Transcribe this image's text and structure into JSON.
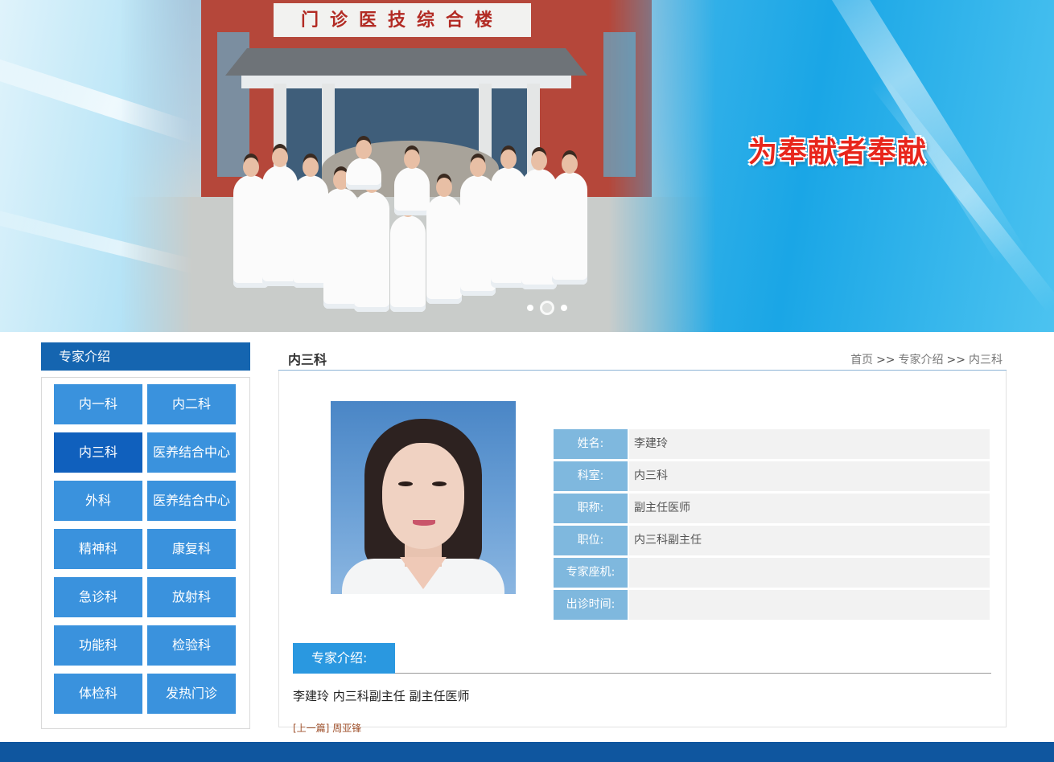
{
  "banner": {
    "building_sign": "门诊医技综合楼",
    "slogan": "为奉献者奉献",
    "slides": 3,
    "active_slide": 1
  },
  "sidebar": {
    "title": "专家介绍",
    "departments": [
      "内一科",
      "内二科",
      "内三科",
      "医养结合中心",
      "外科",
      "医养结合中心",
      "精神科",
      "康复科",
      "急诊科",
      "放射科",
      "功能科",
      "检验科",
      "体检科",
      "发热门诊"
    ],
    "active_index": 2
  },
  "main": {
    "title": "内三科",
    "breadcrumb": {
      "home": "首页",
      "sep1": ">>",
      "section": "专家介绍",
      "sep2": ">>",
      "current": "内三科"
    },
    "profile": [
      {
        "label": "姓名:",
        "value": "李建玲"
      },
      {
        "label": "科室:",
        "value": "内三科"
      },
      {
        "label": "职称:",
        "value": "副主任医师"
      },
      {
        "label": "职位:",
        "value": "内三科副主任"
      },
      {
        "label": "专家座机:",
        "value": ""
      },
      {
        "label": "出诊时间:",
        "value": ""
      }
    ],
    "intro_tab": "专家介绍:",
    "intro_text": "李建玲 内三科副主任 副主任医师",
    "prev_label": "[上一篇]",
    "prev_name": "周亚锋"
  },
  "colors": {
    "primary": "#1565b0",
    "dept_button": "#3a92dd",
    "dept_active": "#1060bd",
    "label_bg": "#7fb8de",
    "intro_tab": "#2a98e0",
    "footer": "#0f569f"
  }
}
